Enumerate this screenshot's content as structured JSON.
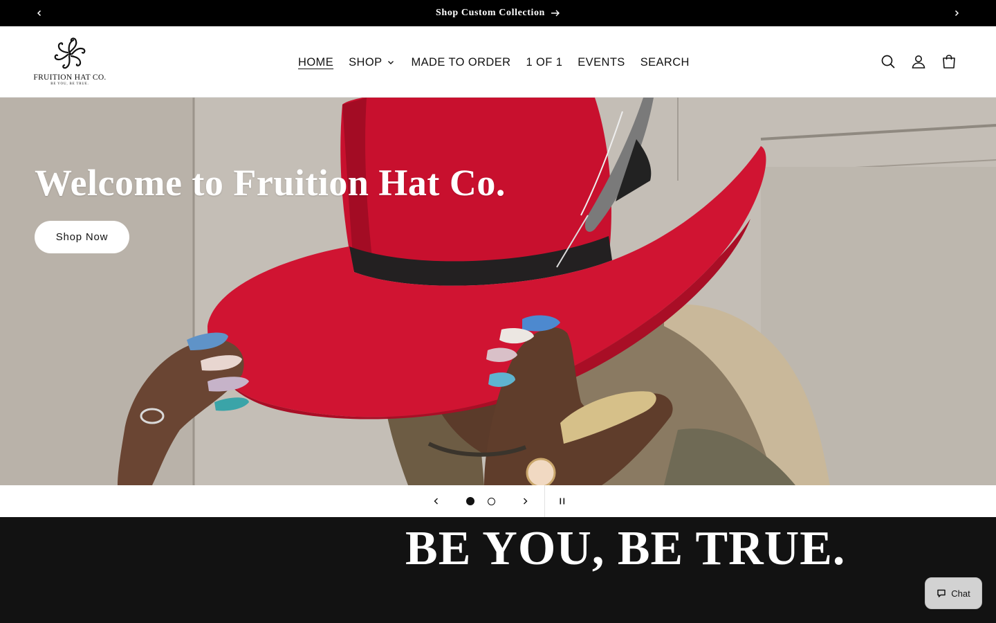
{
  "announcement": {
    "text": "Shop Custom Collection",
    "prev_icon": "chevron-left-icon",
    "next_icon": "chevron-right-icon",
    "arrow_icon": "arrow-right-icon"
  },
  "header": {
    "logo": {
      "name": "FRUITION HAT CO.",
      "tagline": "BE YOU, BE TRUE."
    },
    "nav": [
      {
        "label": "HOME",
        "active": true
      },
      {
        "label": "SHOP",
        "has_dropdown": true
      },
      {
        "label": "MADE TO ORDER"
      },
      {
        "label": "1 OF 1"
      },
      {
        "label": "EVENTS"
      },
      {
        "label": "SEARCH"
      }
    ],
    "icons": [
      "search-icon",
      "account-icon",
      "cart-icon"
    ]
  },
  "hero": {
    "heading": "Welcome to Fruition Hat Co.",
    "cta_label": "Shop Now"
  },
  "slider": {
    "slide_count": 2,
    "current_slide": 1,
    "prev_icon": "chevron-left-icon",
    "next_icon": "chevron-right-icon",
    "pause_icon": "pause-icon"
  },
  "tagline": {
    "text": "BE YOU, BE TRUE."
  },
  "chat": {
    "label": "Chat",
    "icon": "chat-bubble-icon"
  },
  "colors": {
    "announcement_bg": "#000000",
    "header_bg": "#ffffff",
    "hat_red": "#c8102e",
    "tagline_bg": "#121212",
    "text_dark": "#121212"
  }
}
